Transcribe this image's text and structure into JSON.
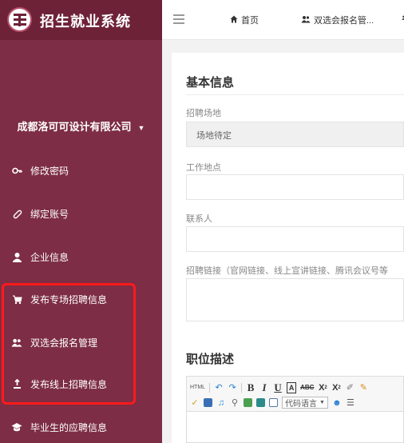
{
  "app": {
    "title": "招生就业系统"
  },
  "sidebar": {
    "company": "成都洛可可设计有限公司",
    "items": [
      {
        "label": "修改密码",
        "icon": "key-icon"
      },
      {
        "label": "绑定账号",
        "icon": "link-icon"
      },
      {
        "label": "企业信息",
        "icon": "user-icon"
      },
      {
        "label": "发布专场招聘信息",
        "icon": "cart-icon"
      },
      {
        "label": "双选会报名管理",
        "icon": "users-icon"
      },
      {
        "label": "发布线上招聘信息",
        "icon": "upload-icon"
      },
      {
        "label": "毕业生的应聘信息",
        "icon": "graduation-cap-icon"
      }
    ]
  },
  "topbar": {
    "tabs": [
      {
        "label": "首页",
        "icon": "home-icon"
      },
      {
        "label": "双选会报名管...",
        "icon": "users-icon"
      }
    ]
  },
  "form": {
    "section_basic": "基本信息",
    "venue_label": "招聘场地",
    "venue_value": "场地待定",
    "location_label": "工作地点",
    "contact_label": "联系人",
    "link_label": "招聘链接（官网链接、线上宣讲链接、腾讯会议号等",
    "section_job": "职位描述"
  },
  "editor": {
    "html_label": "HTML",
    "code_lang": "代码语言"
  },
  "colors": {
    "sidebar_bg": "#7d2d45",
    "brand_bg": "#6e2238",
    "highlight": "#ff1a1a"
  }
}
